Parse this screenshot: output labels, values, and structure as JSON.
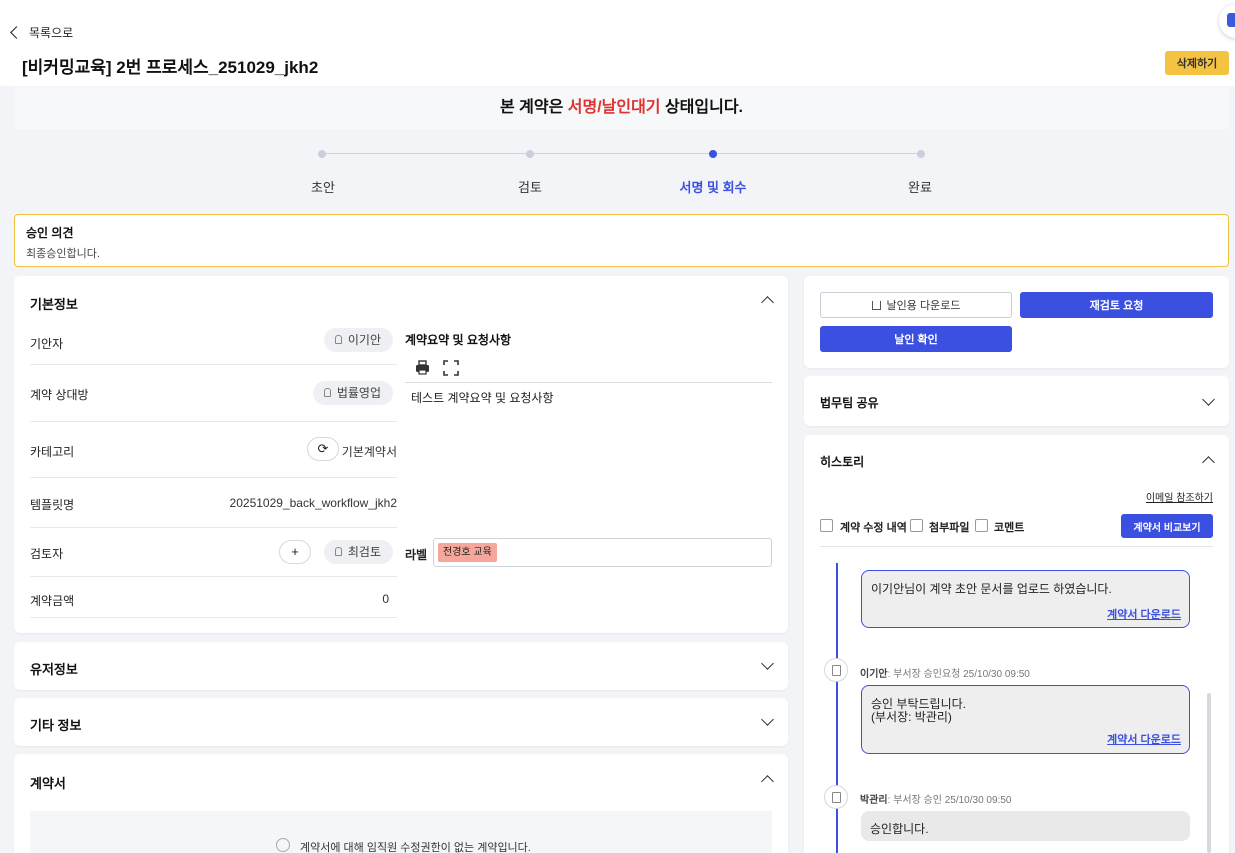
{
  "header": {
    "back_label": "목록으로",
    "title": "[비커밍교육] 2번 프로세스_251029_jkh2",
    "delete_label": "삭제하기"
  },
  "banner": {
    "prefix": "본 계약은 ",
    "status": "서명/날인대기",
    "suffix": " 상태입니다."
  },
  "stepper": {
    "steps": [
      "초안",
      "검토",
      "서명 및 회수",
      "완료"
    ],
    "active_index": 2
  },
  "opinion": {
    "title": "승인 의견",
    "body": "최종승인합니다."
  },
  "basic_info": {
    "title": "기본정보",
    "drafter_label": "기안자",
    "drafter_value": "이기안",
    "counterparty_label": "계약 상대방",
    "counterparty_value": "법률영업",
    "category_label": "카테고리",
    "category_value": "기본계약서",
    "template_label": "템플릿명",
    "template_value": "20251029_back_workflow_jkh2",
    "reviewer_label": "검토자",
    "reviewer_add": "+",
    "reviewer_value": "최검토",
    "amount_label": "계약금액",
    "amount_value": "0",
    "summary_label": "계약요약 및 요청사항",
    "summary_content": "테스트 계약요약 및 요청사항",
    "label_field_label": "라벨",
    "label_tag": "전경호 교육"
  },
  "collapsed_sections": {
    "user_info": "유저정보",
    "etc_info": "기타 정보",
    "contract": "계약서"
  },
  "contract_section": {
    "notice": "계약서에 대해 임직원 수정권한이 없는 계약입니다."
  },
  "actions": {
    "download_seal": "날인용 다운로드",
    "request_rereview": "재검토 요청",
    "confirm_seal": "날인 확인"
  },
  "legal_share": {
    "title": "법무팀 공유"
  },
  "history": {
    "title": "히스토리",
    "email_ref": "이메일 참조하기",
    "filters": [
      "계약 수정 내역",
      "첨부파일",
      "코멘트"
    ],
    "compare_button": "계약서 비교보기",
    "entries": [
      {
        "author": "",
        "meta": "",
        "message_lines": [
          "이기안님이 계약 초안 문서를 업로드 하였습니다."
        ],
        "download_label": "계약서 다운로드"
      },
      {
        "author": "이기안",
        "meta": ": 부서장 승인요청 25/10/30 09:50",
        "message_lines": [
          "승인 부탁드립니다.",
          "(부서장: 박관리)"
        ],
        "download_label": "계약서 다운로드"
      },
      {
        "author": "박관리",
        "meta": ": 부서장 승인 25/10/30 09:50",
        "message_lines": [
          "승인합니다."
        ],
        "download_label": ""
      }
    ]
  },
  "colors": {
    "accent": "#3b4fe0",
    "status_red": "#e03131",
    "delete_yellow": "#f5c342",
    "opinion_border": "#f0c040",
    "label_tag": "#f4a79a"
  }
}
